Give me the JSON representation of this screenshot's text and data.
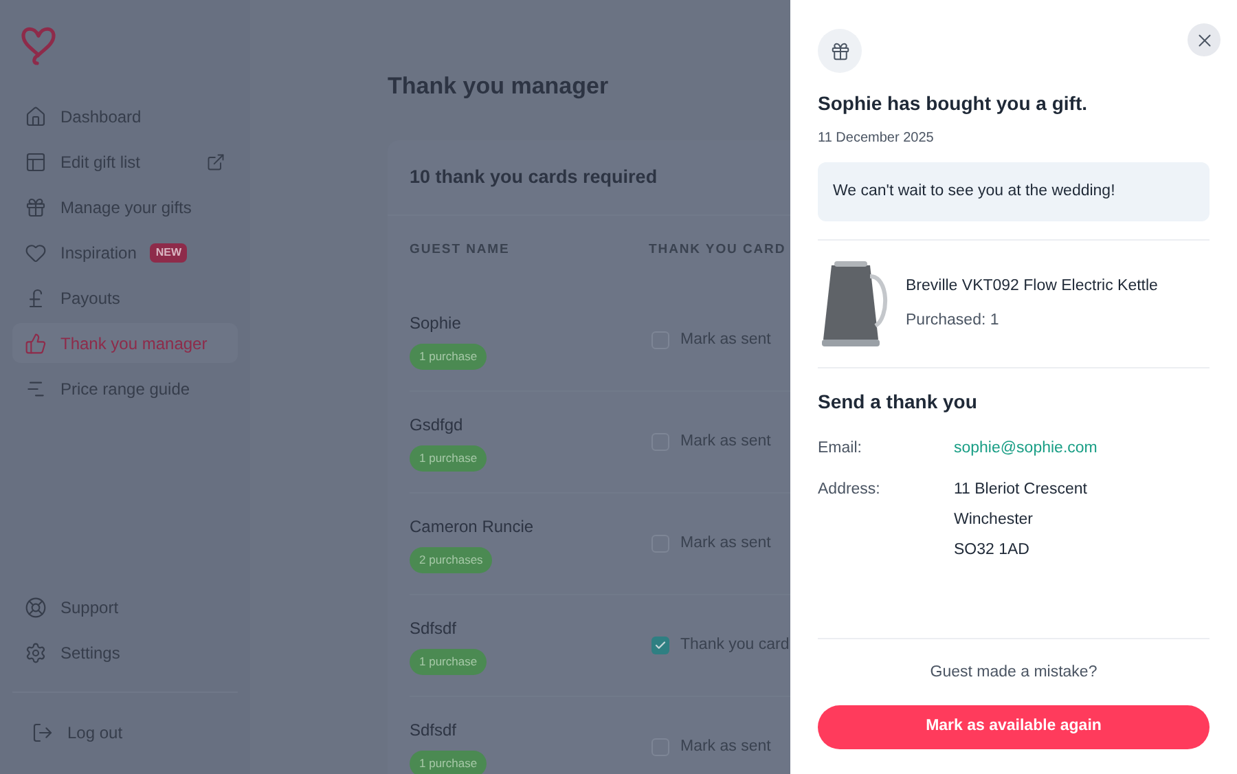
{
  "sidebar": {
    "items": [
      {
        "label": "Dashboard",
        "kind": "home",
        "selected": false
      },
      {
        "label": "Edit gift list",
        "kind": "layout",
        "selected": false,
        "external": true
      },
      {
        "label": "Manage your gifts",
        "kind": "gift",
        "selected": false
      },
      {
        "label": "Inspiration",
        "kind": "heart",
        "selected": false,
        "badge": "NEW"
      },
      {
        "label": "Payouts",
        "kind": "pound",
        "selected": false
      },
      {
        "label": "Thank you manager",
        "kind": "thumbs",
        "selected": true
      },
      {
        "label": "Price range guide",
        "kind": "chart",
        "selected": false
      }
    ],
    "footer_items": [
      {
        "label": "Support",
        "kind": "lifebuoy"
      },
      {
        "label": "Settings",
        "kind": "gear"
      }
    ],
    "logout": "Log out"
  },
  "page": {
    "title": "Thank you manager",
    "card_title": "10 thank you cards required",
    "columns": [
      "GUEST NAME",
      "THANK YOU CARD"
    ],
    "rows": [
      {
        "name": "Sophie",
        "purchases": "1 purchase",
        "checked": false,
        "card": "Mark as sent"
      },
      {
        "name": "Gsdfgd",
        "purchases": "1 purchase",
        "checked": false,
        "card": "Mark as sent"
      },
      {
        "name": "Cameron Runcie",
        "purchases": "2 purchases",
        "checked": false,
        "card": "Mark as sent"
      },
      {
        "name": "Sdfsdf",
        "purchases": "1 purchase",
        "checked": true,
        "card": "Thank you card"
      },
      {
        "name": "Sdfsdf",
        "purchases": "1 purchase",
        "checked": false,
        "card": "Mark as sent"
      }
    ]
  },
  "panel": {
    "title": "Sophie has bought you a gift.",
    "date": "11 December 2025",
    "message": "We can't wait to see you at the wedding!",
    "product": {
      "name": "Breville VKT092 Flow Electric Kettle",
      "purchased": "Purchased: 1"
    },
    "section_title": "Send a thank you",
    "email_label": "Email:",
    "email": "sophie@sophie.com",
    "address_label": "Address:",
    "address": [
      "11 Bleriot Crescent",
      "Winchester",
      "SO32 1AD"
    ],
    "mistake": "Guest made a mistake?",
    "button": "Mark as available again"
  }
}
